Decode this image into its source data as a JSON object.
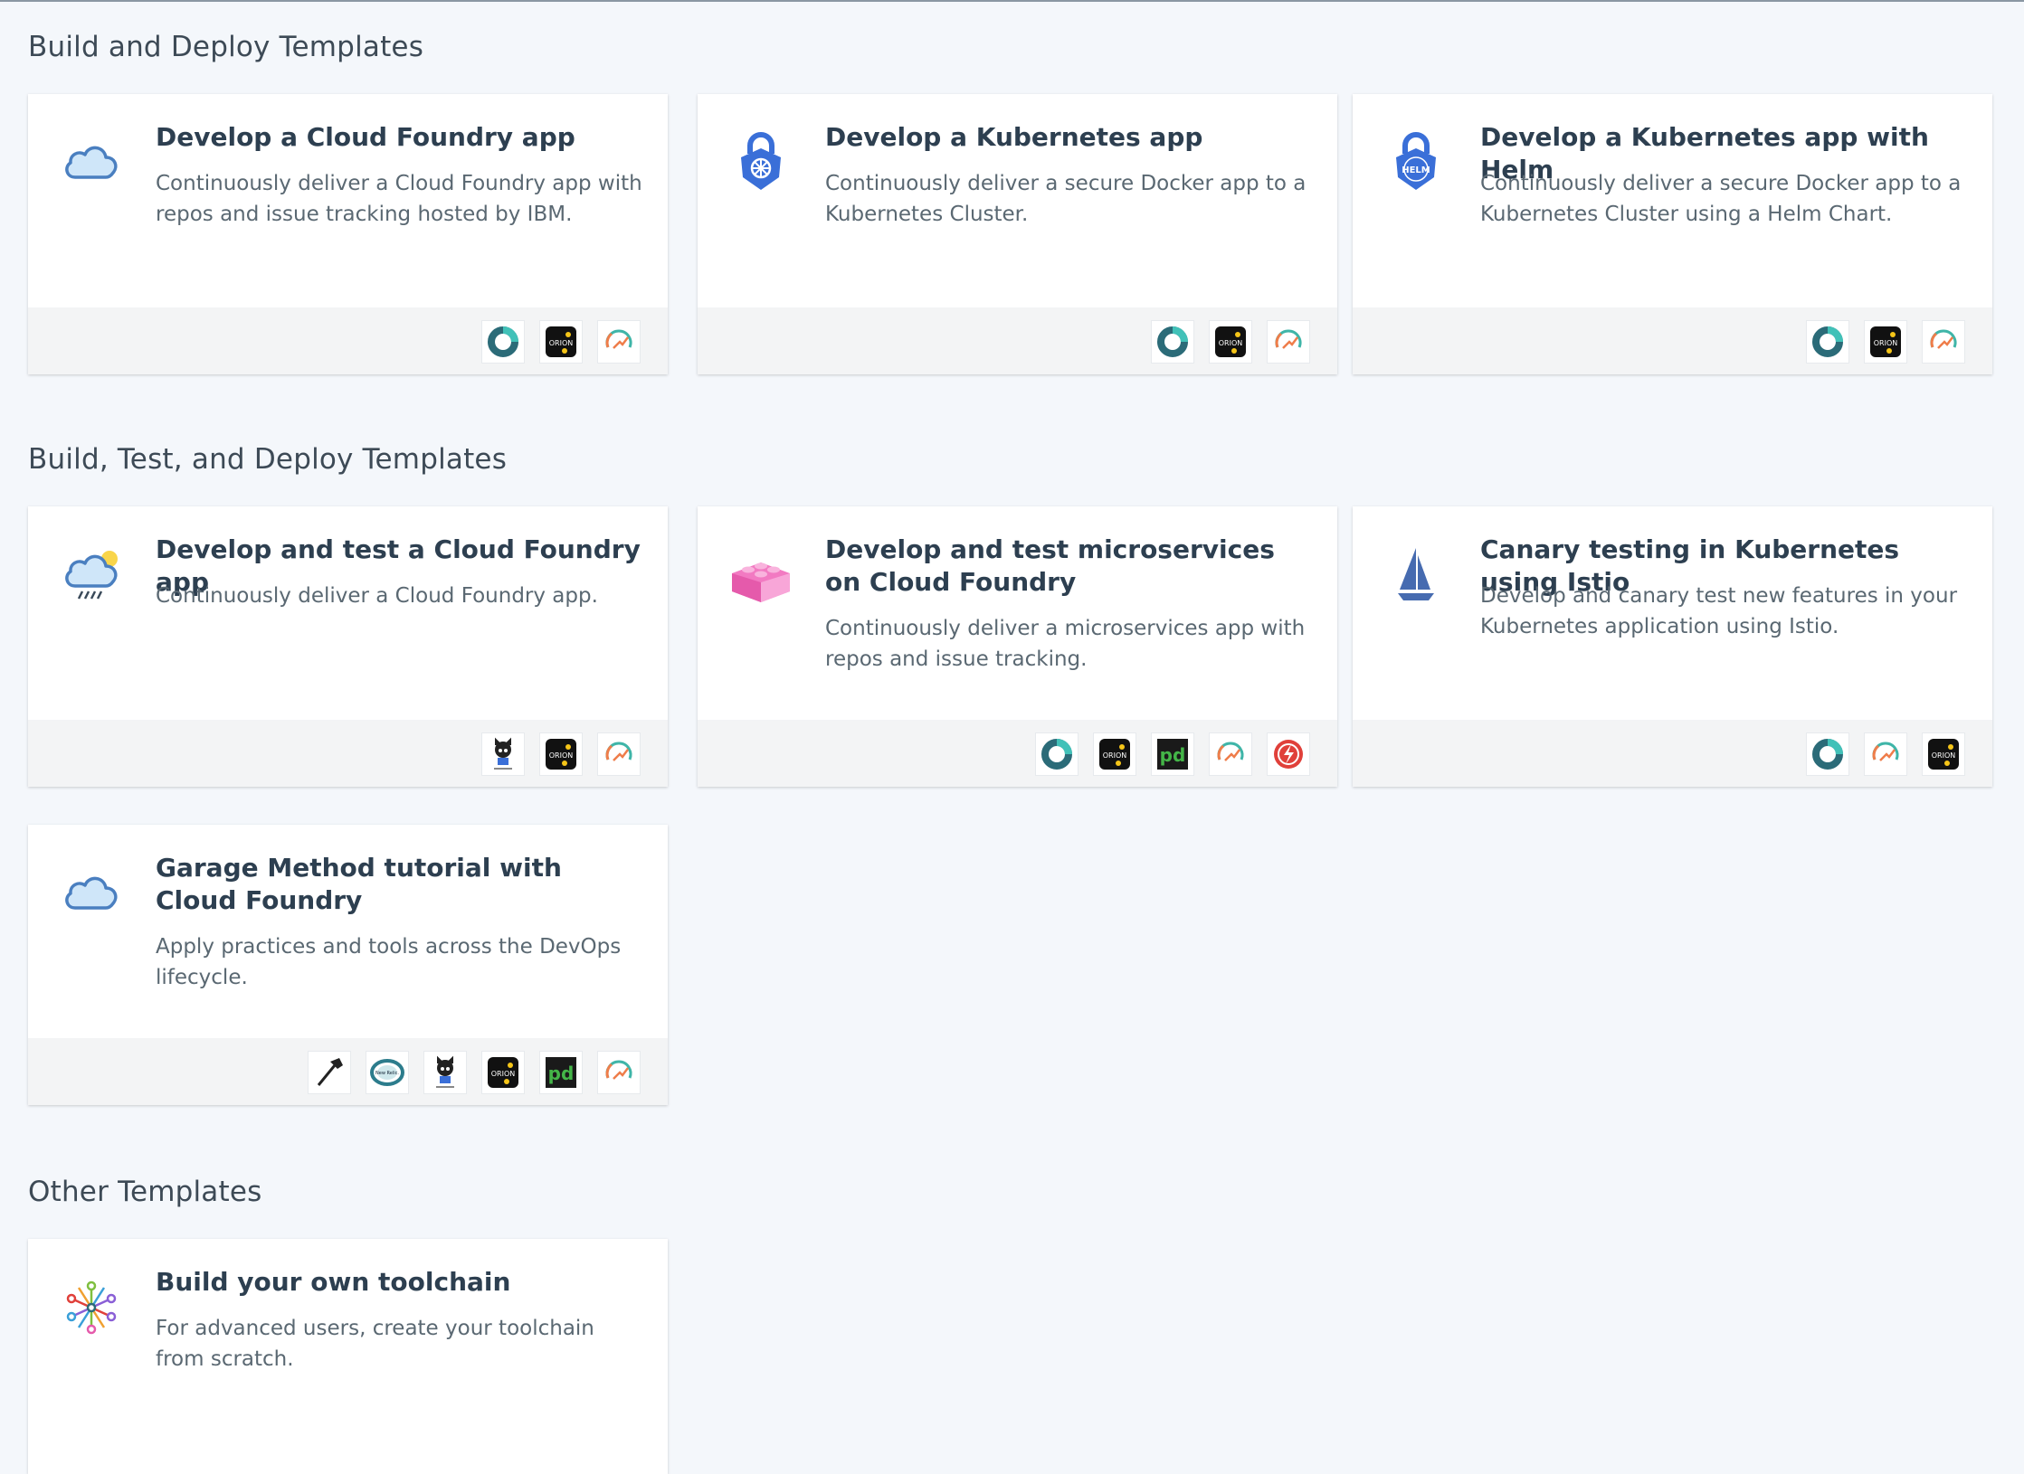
{
  "sections": [
    {
      "title": "Build and Deploy Templates"
    },
    {
      "title": "Build, Test, and Deploy Templates"
    },
    {
      "title": "Other Templates"
    }
  ],
  "cards": [
    {
      "title": "Develop a Cloud Foundry app",
      "description": "Continuously deliver a Cloud Foundry app with repos and issue tracking hosted by IBM.",
      "icon": "cloud-icon",
      "tools": [
        "delivery-pipeline-icon",
        "orion-web-ide-icon",
        "devops-insights-icon"
      ]
    },
    {
      "title": "Develop a Kubernetes app",
      "description": "Continuously deliver a secure Docker app to a Kubernetes Cluster.",
      "icon": "kubernetes-lock-icon",
      "tools": [
        "delivery-pipeline-icon",
        "orion-web-ide-icon",
        "devops-insights-icon"
      ]
    },
    {
      "title": "Develop a Kubernetes app with Helm",
      "description": "Continuously deliver a secure Docker app to a Kubernetes Cluster using a Helm Chart.",
      "icon": "helm-lock-icon",
      "icon_label": "HELM",
      "tools": [
        "delivery-pipeline-icon",
        "orion-web-ide-icon",
        "devops-insights-icon"
      ]
    },
    {
      "title": "Develop and test a Cloud Foundry app",
      "description": "Continuously deliver a Cloud Foundry app.",
      "icon": "cloud-rain-icon",
      "tools": [
        "github-icon",
        "orion-web-ide-icon",
        "devops-insights-icon"
      ]
    },
    {
      "title": "Develop and test microservices on Cloud Foundry",
      "description": "Continuously deliver a microservices app with repos and issue tracking.",
      "icon": "lego-brick-icon",
      "tools": [
        "delivery-pipeline-icon",
        "orion-web-ide-icon",
        "pagerduty-icon",
        "devops-insights-icon",
        "slack-alert-icon"
      ]
    },
    {
      "title": "Canary testing in Kubernetes using Istio",
      "description": "Develop and canary test new features in your Kubernetes application using Istio.",
      "icon": "istio-sail-icon",
      "tools": [
        "delivery-pipeline-icon",
        "devops-insights-icon",
        "orion-web-ide-icon"
      ]
    },
    {
      "title": "Garage Method tutorial with Cloud Foundry",
      "description": "Apply practices and tools across the DevOps lifecycle.",
      "icon": "cloud-icon",
      "tools": [
        "hammer-icon",
        "new-relic-icon",
        "github-icon",
        "orion-web-ide-icon",
        "pagerduty-icon",
        "devops-insights-icon"
      ]
    },
    {
      "title": "Build your own toolchain",
      "description": "For advanced users, create your toolchain from scratch.",
      "icon": "toolchain-network-icon",
      "tools": []
    }
  ],
  "tool_labels": {
    "orion": "ORION",
    "pagerduty": "pd",
    "new_relic": "New Relic."
  },
  "colors": {
    "background": "#f4f7fb",
    "card": "#ffffff",
    "footer": "#f3f4f5",
    "title": "#2d3f50",
    "text": "#5a6872",
    "kube_blue": "#3a6fd8"
  }
}
